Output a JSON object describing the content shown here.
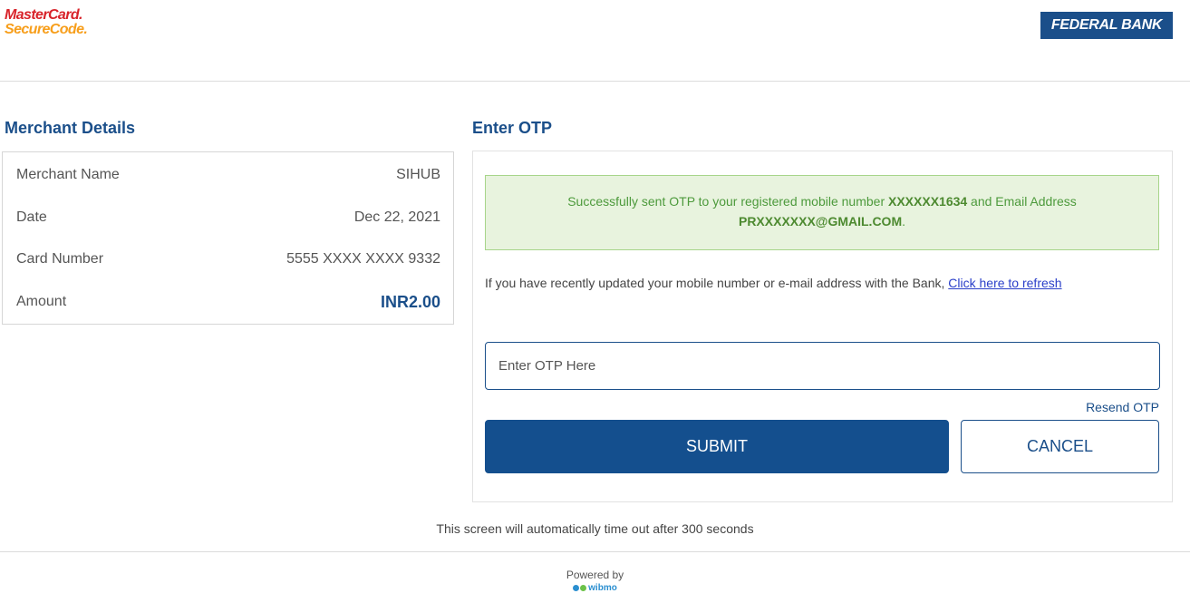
{
  "header": {
    "mastercard_line1": "MasterCard.",
    "mastercard_line2": "SecureCode.",
    "bank_logo": "FEDERAL BANK",
    "brand_colors": {
      "bank_blue": "#1b4f8a",
      "mc_red": "#d8232a",
      "mc_orange": "#f79e1b"
    }
  },
  "merchant": {
    "title": "Merchant Details",
    "rows": [
      {
        "label": "Merchant Name",
        "value": "SIHUB"
      },
      {
        "label": "Date",
        "value": "Dec 22, 2021"
      },
      {
        "label": "Card Number",
        "value": "5555 XXXX XXXX 9332"
      },
      {
        "label": "Amount",
        "value": "INR2.00"
      }
    ]
  },
  "otp": {
    "title": "Enter OTP",
    "success": {
      "text_part1": "Successfully sent OTP to your registered mobile number ",
      "mobile": "XXXXXX1634",
      "text_part2": " and Email Address",
      "email": "PRXXXXXXX@GMAIL.COM",
      "text_part3": ".",
      "colors": {
        "bg": "#e8f3de",
        "border": "#a7d58a",
        "text": "#4d9a3c"
      }
    },
    "info_text": "If you have recently updated your mobile number or e-mail address with the Bank, ",
    "refresh_link": "Click here to refresh",
    "input_placeholder": "Enter OTP Here",
    "input_value": "",
    "resend_label": "Resend OTP",
    "submit_label": "SUBMIT",
    "cancel_label": "CANCEL"
  },
  "footer": {
    "timeout_text": "This screen will automatically time out after 300 seconds",
    "powered_by": "Powered by",
    "wibmo_logo": "wibmo"
  }
}
